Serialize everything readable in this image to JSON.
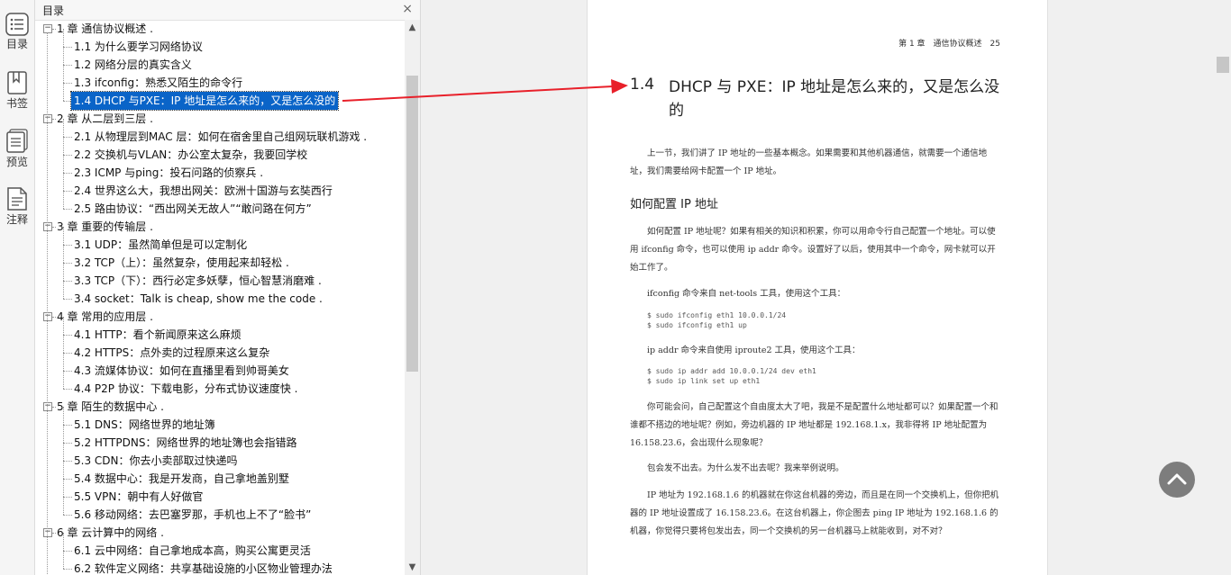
{
  "rail": {
    "items": [
      {
        "label": "目录",
        "icon": "toc-icon"
      },
      {
        "label": "书签",
        "icon": "bookmark-icon"
      },
      {
        "label": "预览",
        "icon": "preview-icon"
      },
      {
        "label": "注释",
        "icon": "annotation-icon"
      }
    ]
  },
  "toc": {
    "title": "目录",
    "close": "×",
    "rows": [
      {
        "text": "1 章 通信协议概述 .",
        "level": 0
      },
      {
        "text": "1.1 为什么要学习网络协议",
        "level": 1
      },
      {
        "text": "1.2 网络分层的真实含义",
        "level": 1
      },
      {
        "text": "1.3 ifconfig：熟悉又陌生的命令行",
        "level": 1
      },
      {
        "text": "1.4 DHCP 与PXE：IP 地址是怎么来的，又是怎么没的",
        "level": 1,
        "selected": true
      },
      {
        "text": "2 章 从二层到三层 .",
        "level": 0
      },
      {
        "text": "2.1 从物理层到MAC 层：如何在宿舍里自己组网玩联机游戏 .",
        "level": 1
      },
      {
        "text": "2.2 交换机与VLAN：办公室太复杂，我要回学校",
        "level": 1
      },
      {
        "text": "2.3 ICMP 与ping：投石问路的侦察兵 .",
        "level": 1
      },
      {
        "text": "2.4 世界这么大，我想出网关：欧洲十国游与玄奘西行",
        "level": 1
      },
      {
        "text": "2.5 路由协议：“西出网关无故人”“敢问路在何方”",
        "level": 1
      },
      {
        "text": "3 章 重要的传输层 .",
        "level": 0
      },
      {
        "text": "3.1 UDP：虽然简单但是可以定制化",
        "level": 1
      },
      {
        "text": "3.2 TCP（上）：虽然复杂，使用起来却轻松 .",
        "level": 1
      },
      {
        "text": "3.3 TCP（下）：西行必定多妖孽，恒心智慧消磨难 .",
        "level": 1
      },
      {
        "text": "3.4 socket：Talk is cheap, show me the code .",
        "level": 1
      },
      {
        "text": "4 章 常用的应用层 .",
        "level": 0
      },
      {
        "text": "4.1 HTTP：看个新闻原来这么麻烦",
        "level": 1
      },
      {
        "text": "4.2 HTTPS：点外卖的过程原来这么复杂",
        "level": 1
      },
      {
        "text": "4.3 流媒体协议：如何在直播里看到帅哥美女",
        "level": 1
      },
      {
        "text": "4.4 P2P 协议：下载电影，分布式协议速度快 .",
        "level": 1
      },
      {
        "text": "5 章 陌生的数据中心 .",
        "level": 0
      },
      {
        "text": "5.1 DNS：网络世界的地址簿",
        "level": 1
      },
      {
        "text": "5.2 HTTPDNS：网络世界的地址簿也会指错路",
        "level": 1
      },
      {
        "text": "5.3 CDN：你去小卖部取过快递吗",
        "level": 1
      },
      {
        "text": "5.4 数据中心：我是开发商，自己拿地盖别墅",
        "level": 1
      },
      {
        "text": "5.5 VPN：朝中有人好做官",
        "level": 1
      },
      {
        "text": "5.6 移动网络：去巴塞罗那，手机也上不了“脸书”",
        "level": 1
      },
      {
        "text": "6 章 云计算中的网络 .",
        "level": 0
      },
      {
        "text": "6.1 云中网络：自己拿地成本高，购买公寓更灵活",
        "level": 1
      },
      {
        "text": "6.2 软件定义网络：共享基础设施的小区物业管理办法",
        "level": 1
      }
    ]
  },
  "page": {
    "running_head": "第 1 章　通信协议概述　25",
    "section_number": "1.4",
    "section_title": "DHCP 与 PXE：IP 地址是怎么来的，又是怎么没的",
    "para1": "上一节，我们讲了 IP 地址的一些基本概念。如果需要和其他机器通信，就需要一个通信地址，我们需要给网卡配置一个 IP 地址。",
    "subhead": "如何配置 IP 地址",
    "para2": "如何配置 IP 地址呢？如果有相关的知识和积累，你可以用命令行自己配置一个地址。可以使用 ifconfig 命令，也可以使用 ip addr 命令。设置好了以后，使用其中一个命令，网卡就可以开始工作了。",
    "para3": "ifconfig 命令来自 net-tools 工具，使用这个工具：",
    "code1": "$ sudo ifconfig eth1 10.0.0.1/24\n$ sudo ifconfig eth1 up",
    "para4": "ip addr 命令来自使用 iproute2 工具，使用这个工具：",
    "code2": "$ sudo ip addr add 10.0.0.1/24 dev eth1\n$ sudo ip link set up eth1",
    "para5": "你可能会问，自己配置这个自由度太大了吧，我是不是配置什么地址都可以？如果配置一个和谁都不搭边的地址呢？例如，旁边机器的 IP 地址都是 192.168.1.x，我非得将 IP 地址配置为 16.158.23.6，会出现什么现象呢？",
    "para6": "包会发不出去。为什么发不出去呢？我来举例说明。",
    "para7": "IP 地址为 192.168.1.6 的机器就在你这台机器的旁边，而且是在同一个交换机上，但你把机器的 IP 地址设置成了 16.158.23.6。在这台机器上，你企图去 ping IP 地址为 192.168.1.6 的机器，你觉得只要将包发出去，同一个交换机的另一台机器马上就能收到，对不对？"
  },
  "colors": {
    "selection": "#0a64c8",
    "annotation_arrow": "#e8202a",
    "back_to_top": "#7d7d7d"
  }
}
